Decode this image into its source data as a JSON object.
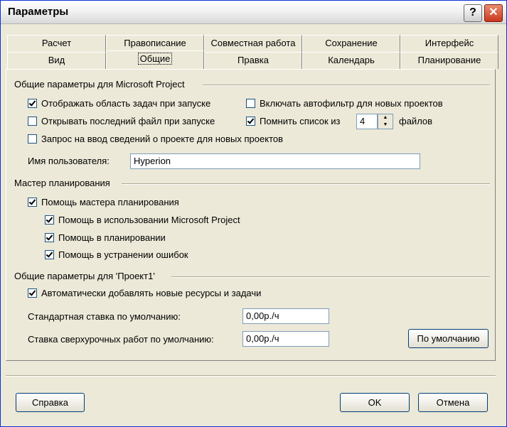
{
  "window": {
    "title": "Параметры",
    "help_label": "?",
    "close_label": "✕"
  },
  "tabs": {
    "row1": [
      "Расчет",
      "Правописание",
      "Совместная работа",
      "Сохранение",
      "Интерфейс"
    ],
    "row2": [
      "Вид",
      "Общие",
      "Правка",
      "Календарь",
      "Планирование"
    ],
    "active": "Общие"
  },
  "general": {
    "title": "Общие параметры для Microsoft Project",
    "show_taskpane": {
      "label": "Отображать область задач при запуске",
      "checked": true
    },
    "autofilter": {
      "label": "Включать автофильтр для новых проектов",
      "checked": false
    },
    "open_last": {
      "label": "Открывать последний файл при запуске",
      "checked": false
    },
    "recent_list": {
      "label": "Помнить список из",
      "checked": true,
      "value": "4",
      "suffix": "файлов"
    },
    "prompt_info": {
      "label": "Запрос на ввод сведений о проекте для новых проектов",
      "checked": false
    },
    "user_name": {
      "label": "Имя пользователя:",
      "value": "Hyperion"
    }
  },
  "wizard": {
    "title": "Мастер планирования",
    "main": {
      "label": "Помощь мастера планирования",
      "checked": true
    },
    "use": {
      "label": "Помощь в использовании Microsoft Project",
      "checked": true
    },
    "scheduling": {
      "label": "Помощь в планировании",
      "checked": true
    },
    "errors": {
      "label": "Помощь в устранении ошибок",
      "checked": true
    }
  },
  "project": {
    "title": "Общие параметры для 'Проект1'",
    "auto_add": {
      "label": "Автоматически добавлять новые ресурсы и задачи",
      "checked": true
    },
    "std_rate": {
      "label": "Стандартная ставка по умолчанию:",
      "value": "0,00р./ч"
    },
    "ovt_rate": {
      "label": "Ставка сверхурочных работ по умолчанию:",
      "value": "0,00р./ч"
    },
    "default_button": "По умолчанию"
  },
  "footer": {
    "help": "Справка",
    "ok": "OK",
    "cancel": "Отмена"
  }
}
